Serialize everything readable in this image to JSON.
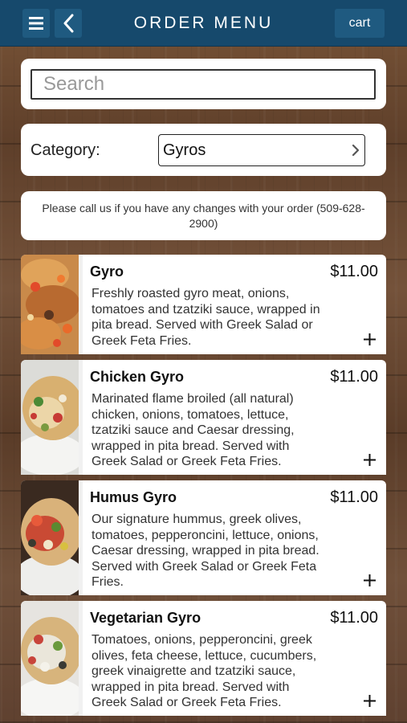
{
  "header": {
    "title": "ORDER MENU",
    "cart_label": "cart",
    "menu_icon": "hamburger-icon",
    "back_icon": "chevron-left-icon"
  },
  "search": {
    "placeholder": "Search",
    "value": ""
  },
  "category": {
    "label": "Category:",
    "selected": "Gyros"
  },
  "notice": {
    "text": "Please call us if you have any changes with your order (509-628-2900)"
  },
  "menu_items": [
    {
      "name": "Gyro",
      "price": "$11.00",
      "description": "Freshly roasted gyro meat, onions, tomatoes and tzatziki sauce, wrapped in pita bread. Served with Greek Salad or Greek Feta Fries."
    },
    {
      "name": "Chicken Gyro",
      "price": "$11.00",
      "description": "Marinated flame broiled (all natural) chicken, onions, tomatoes, lettuce, tzatziki sauce and Caesar dressing, wrapped in pita bread. Served with Greek Salad or Greek Feta Fries."
    },
    {
      "name": "Humus Gyro",
      "price": "$11.00",
      "description": "Our signature hummus, greek olives, tomatoes, pepperoncini, lettuce, onions, Caesar dressing, wrapped in pita bread. Served with Greek Salad or Greek Feta Fries."
    },
    {
      "name": "Vegetarian Gyro",
      "price": "$11.00",
      "description": "Tomatoes, onions, pepperoncini, greek olives, feta cheese, lettuce, cucumbers, greek vinaigrette and tzatziki sauce, wrapped in pita bread. Served with Greek Salad or Greek Feta Fries."
    }
  ],
  "colors": {
    "header": "#16496c",
    "header_button": "#1f5a80",
    "card": "#ffffff"
  }
}
